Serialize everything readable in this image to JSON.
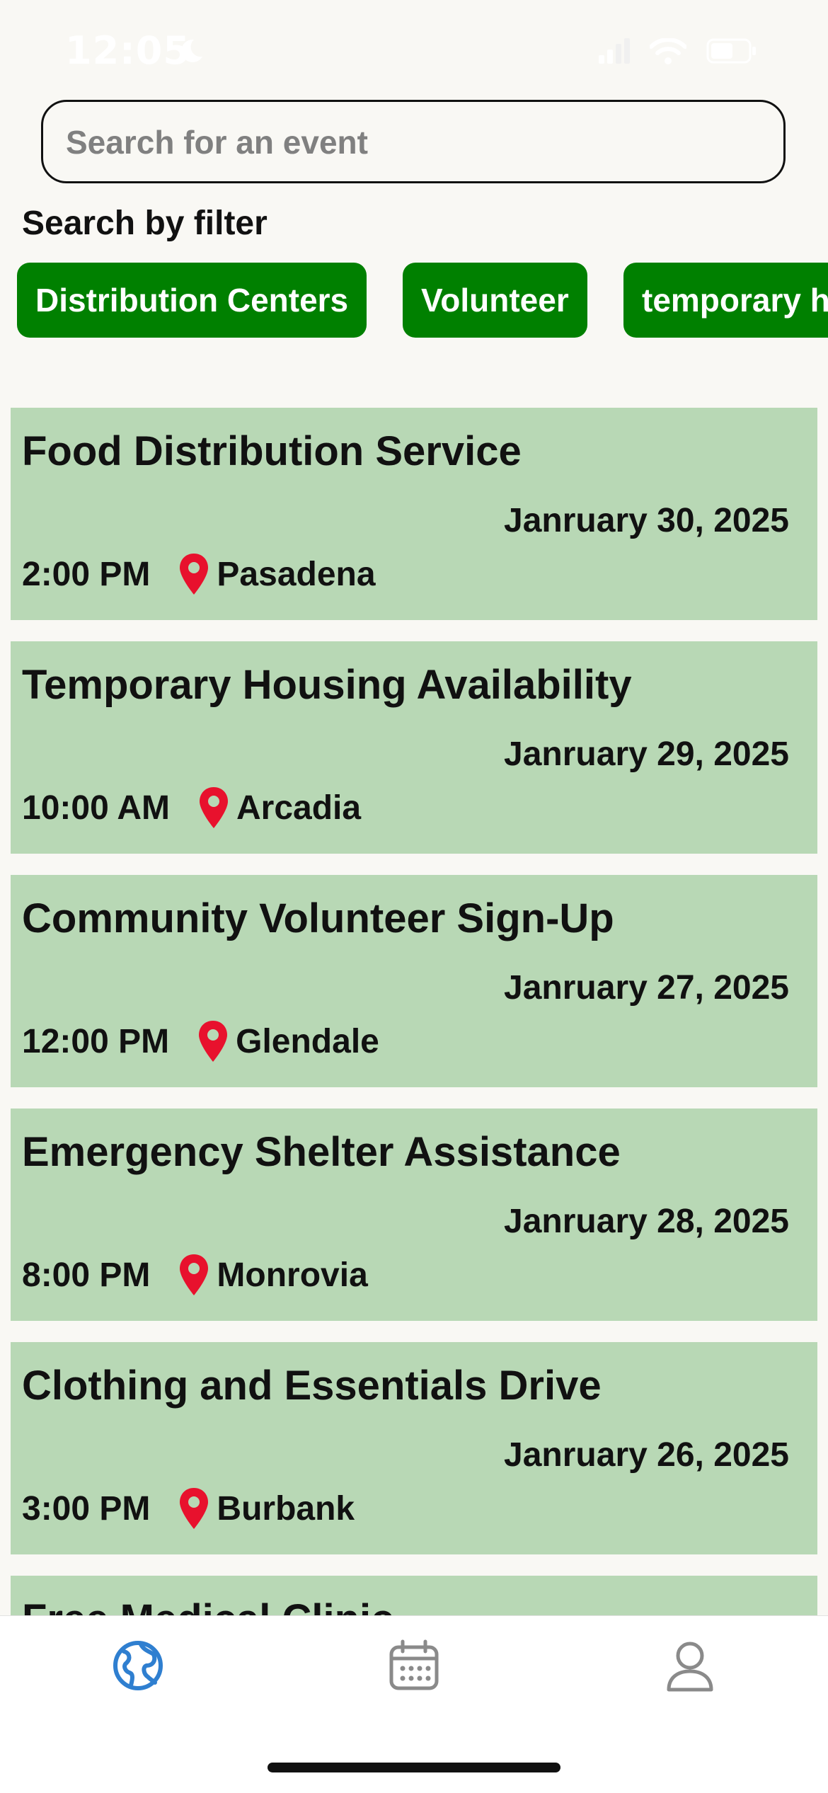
{
  "status_bar": {
    "time": "12:05"
  },
  "search": {
    "placeholder": "Search for an event"
  },
  "filters": {
    "label": "Search by filter",
    "chips": [
      "Distribution Centers",
      "Volunteer",
      "temporary h"
    ]
  },
  "events": [
    {
      "title": "Food Distribution Service",
      "date": "Janruary 30, 2025",
      "time": "2:00 PM",
      "location": "Pasadena"
    },
    {
      "title": "Temporary Housing Availability",
      "date": "Janruary 29, 2025",
      "time": "10:00 AM",
      "location": "Arcadia"
    },
    {
      "title": "Community Volunteer Sign-Up",
      "date": "Janruary 27, 2025",
      "time": "12:00 PM",
      "location": "Glendale"
    },
    {
      "title": "Emergency Shelter Assistance",
      "date": "Janruary 28, 2025",
      "time": "8:00 PM",
      "location": "Monrovia"
    },
    {
      "title": "Clothing and Essentials Drive",
      "date": "Janruary 26, 2025",
      "time": "3:00 PM",
      "location": "Burbank"
    },
    {
      "title": "Free Medical Clinic"
    }
  ],
  "tab_bar": {
    "tabs": [
      {
        "icon": "globe-icon",
        "active": true
      },
      {
        "icon": "calendar-icon",
        "active": false
      },
      {
        "icon": "person-icon",
        "active": false
      }
    ]
  },
  "colors": {
    "background": "#f9f8f4",
    "chip": "#008000",
    "card": "#b8d8b5",
    "pin": "#e8112d",
    "tab_active": "#2f7fd0",
    "tab_inactive": "#8a8a8a"
  }
}
